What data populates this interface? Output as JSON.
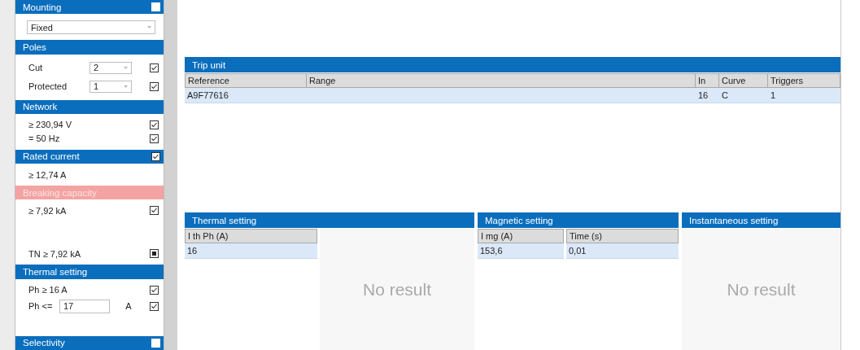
{
  "sidebar": {
    "sections": [
      {
        "title": "Mounting",
        "alert": false,
        "checked": false,
        "rows": [
          {
            "kind": "select",
            "value": "Fixed"
          }
        ]
      },
      {
        "title": "Poles",
        "alert": false,
        "rows": [
          {
            "kind": "select-row",
            "label": "Cut",
            "value": "2",
            "checked": true
          },
          {
            "kind": "select-row",
            "label": "Protected",
            "value": "1",
            "checked": true
          }
        ]
      },
      {
        "title": "Network",
        "alert": false,
        "rows": [
          {
            "kind": "text",
            "label": "≥ 230,94 V",
            "checked": true
          },
          {
            "kind": "text",
            "label": "= 50 Hz",
            "checked": true
          }
        ]
      },
      {
        "title": "Rated current",
        "alert": false,
        "checked": true,
        "rows": [
          {
            "kind": "text",
            "label": "≥ 12,74 A"
          }
        ]
      },
      {
        "title": "Breaking capacity",
        "alert": true,
        "rows": [
          {
            "kind": "text",
            "label": "≥ 7,92 kA",
            "checked": true
          },
          {
            "kind": "bottom-text",
            "label": "TN ≥ 7,92 kA",
            "indeterminate": true
          }
        ]
      },
      {
        "title": "Thermal setting",
        "alert": false,
        "rows": [
          {
            "kind": "text",
            "label": "Ph ≥ 16 A",
            "checked": true
          },
          {
            "kind": "input-row",
            "label": "Ph <=",
            "value": "17",
            "unit": "A",
            "checked": true
          }
        ]
      },
      {
        "title": "Selectivity",
        "alert": false,
        "checked": false
      }
    ]
  },
  "trip_unit": {
    "title": "Trip unit",
    "columns": [
      "Reference",
      "Range",
      "In",
      "Curve",
      "Triggers"
    ],
    "rows": [
      [
        "A9F77616",
        "",
        "16",
        "C",
        "1"
      ]
    ]
  },
  "settings": [
    {
      "title": "Thermal setting",
      "columns": [
        {
          "label": "I th Ph (A)",
          "cells": [
            "16"
          ]
        }
      ],
      "empty_text": "No result"
    },
    {
      "title": "Magnetic setting",
      "columns": [
        {
          "label": "I mg (A)",
          "cells": [
            "153,6"
          ]
        },
        {
          "label": "Time (s)",
          "cells": [
            "0,01"
          ]
        }
      ]
    },
    {
      "title": "Instantaneous setting",
      "empty_text": "No result"
    }
  ]
}
